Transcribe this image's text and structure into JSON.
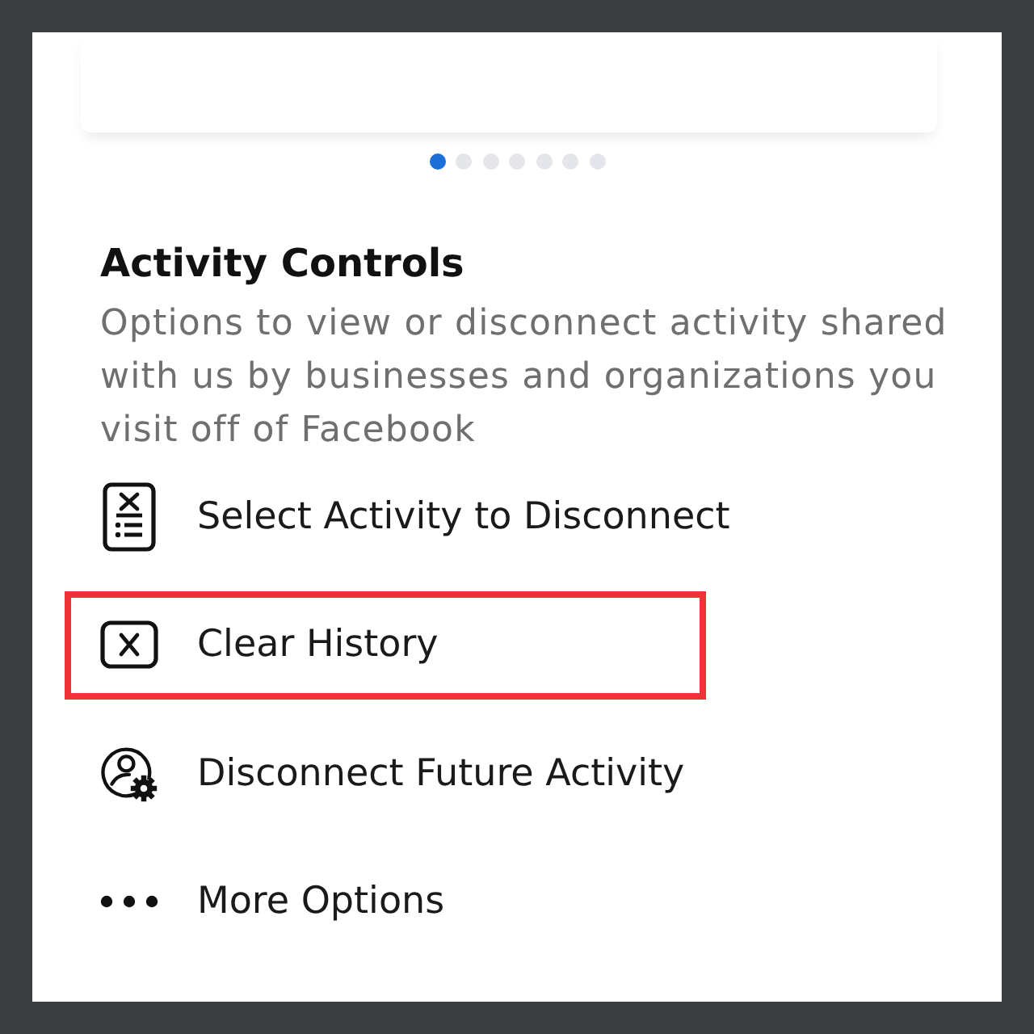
{
  "carousel": {
    "pages": [
      {
        "selected": true
      },
      {
        "selected": false
      },
      {
        "selected": false
      },
      {
        "selected": false
      },
      {
        "selected": false
      },
      {
        "selected": false
      },
      {
        "selected": false
      }
    ]
  },
  "section": {
    "title": "Activity Controls",
    "description": "Options to view or disconnect activity shared with us by businesses and organizations you visit off of Facebook"
  },
  "options": [
    {
      "kind": "select-list",
      "label": "Select Activity to Disconnect",
      "highlighted": false
    },
    {
      "kind": "clear",
      "label": "Clear History",
      "highlighted": true
    },
    {
      "kind": "person-gear",
      "label": "Disconnect Future Activity",
      "highlighted": false
    },
    {
      "kind": "more",
      "label": "More Options",
      "highlighted": false
    }
  ]
}
